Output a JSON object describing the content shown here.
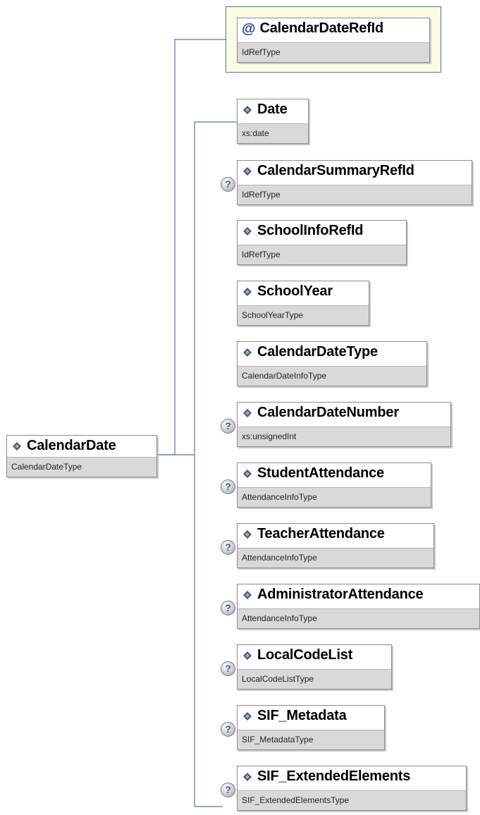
{
  "root": {
    "name": "CalendarDate",
    "type": "CalendarDateType",
    "icon": "element-icon"
  },
  "attribute": {
    "name": "CalendarDateRefId",
    "type": "IdRefType",
    "icon": "attribute-at-icon"
  },
  "children": [
    {
      "name": "Date",
      "type": "xs:date",
      "optional": false
    },
    {
      "name": "CalendarSummaryRefId",
      "type": "IdRefType",
      "optional": true
    },
    {
      "name": "SchoolInfoRefId",
      "type": "IdRefType",
      "optional": false
    },
    {
      "name": "SchoolYear",
      "type": "SchoolYearType",
      "optional": false
    },
    {
      "name": "CalendarDateType",
      "type": "CalendarDateInfoType",
      "optional": false
    },
    {
      "name": "CalendarDateNumber",
      "type": "xs:unsignedInt",
      "optional": true
    },
    {
      "name": "StudentAttendance",
      "type": "AttendanceInfoType",
      "optional": true
    },
    {
      "name": "TeacherAttendance",
      "type": "AttendanceInfoType",
      "optional": true
    },
    {
      "name": "AdministratorAttendance",
      "type": "AttendanceInfoType",
      "optional": true
    },
    {
      "name": "LocalCodeList",
      "type": "LocalCodeListType",
      "optional": true
    },
    {
      "name": "SIF_Metadata",
      "type": "SIF_MetadataType",
      "optional": true
    },
    {
      "name": "SIF_ExtendedElements",
      "type": "SIF_ExtendedElementsType",
      "optional": true
    }
  ],
  "optional_marker": "?",
  "colors": {
    "connector": "#4a7aa8",
    "attribute_bg": "#fcfbe3",
    "type_bar": "#d9d9d9",
    "icon_blue": "#2b5fa8",
    "icon_orange": "#e8a33a"
  }
}
